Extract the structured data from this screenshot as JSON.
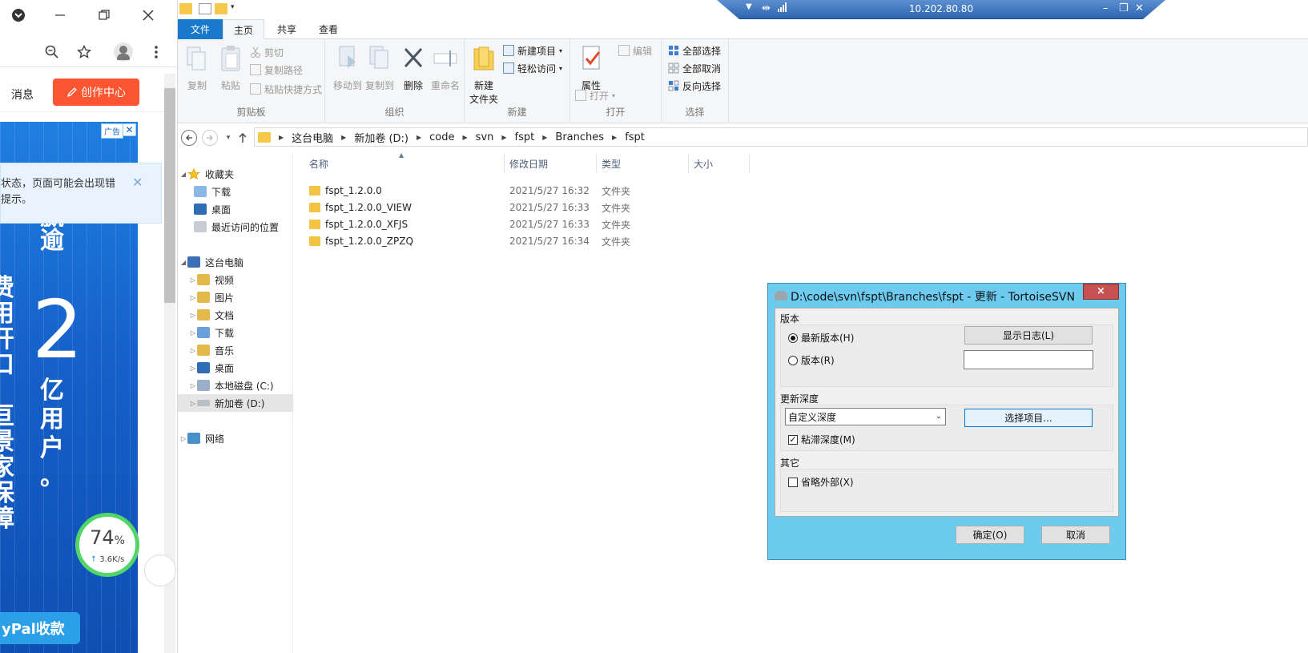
{
  "browser": {
    "zoom_icon": "zoom-out-icon",
    "star_icon": "star-icon",
    "menu_icon": "kebab-menu-icon",
    "messages_label": "消息",
    "create_center_label": "创作中心",
    "ad_badge": "广告",
    "notice_text": "状态，页面可能会出现错\n提示。",
    "ad_text": {
      "col1": [
        "赢",
        "逾"
      ],
      "big_number": "2",
      "col2": [
        "亿",
        "用",
        "户",
        "。"
      ],
      "left_chars": [
        "费",
        "用",
        "开",
        "口",
        "，",
        "亘",
        "景",
        "家",
        "保",
        "障"
      ]
    },
    "speed": {
      "percent": "74",
      "percent_sign": "%",
      "rate": "3.6K/s"
    },
    "paypal_label": "yPal收款"
  },
  "remote_bar": {
    "ip": "10.202.80.80"
  },
  "explorer": {
    "tabs": [
      {
        "label": "文件"
      },
      {
        "label": "主页"
      },
      {
        "label": "共享"
      },
      {
        "label": "查看"
      }
    ],
    "ribbon": {
      "clipboard": {
        "label": "剪贴板",
        "copy": "复制",
        "paste": "粘贴",
        "cut": "剪切",
        "copy_path": "复制路径",
        "paste_shortcut": "粘贴快捷方式"
      },
      "organize": {
        "label": "组织",
        "move_to": "移动到",
        "copy_to": "复制到",
        "delete": "删除",
        "rename": "重命名"
      },
      "new": {
        "label": "新建",
        "new_folder_line1": "新建",
        "new_folder_line2": "文件夹",
        "new_item": "新建项目",
        "easy_access": "轻松访问"
      },
      "open": {
        "label": "打开",
        "properties": "属性",
        "open": "打开",
        "edit": "编辑"
      },
      "select": {
        "label": "选择",
        "select_all": "全部选择",
        "select_none": "全部取消",
        "invert": "反向选择"
      }
    },
    "breadcrumb": [
      "这台电脑",
      "新加卷 (D:)",
      "code",
      "svn",
      "fspt",
      "Branches",
      "fspt"
    ],
    "tree": {
      "favorites": "收藏夹",
      "fav_items": [
        "下载",
        "桌面",
        "最近访问的位置"
      ],
      "this_pc": "这台电脑",
      "pc_items": [
        "视频",
        "图片",
        "文档",
        "下载",
        "音乐",
        "桌面",
        "本地磁盘 (C:)",
        "新加卷 (D:)"
      ],
      "network": "网络"
    },
    "columns": [
      "名称",
      "修改日期",
      "类型",
      "大小"
    ],
    "files": [
      {
        "name": "fspt_1.2.0.0",
        "date": "2021/5/27 16:32",
        "type": "文件夹"
      },
      {
        "name": "fspt_1.2.0.0_VIEW",
        "date": "2021/5/27 16:33",
        "type": "文件夹"
      },
      {
        "name": "fspt_1.2.0.0_XFJS",
        "date": "2021/5/27 16:33",
        "type": "文件夹"
      },
      {
        "name": "fspt_1.2.0.0_ZPZQ",
        "date": "2021/5/27 16:34",
        "type": "文件夹"
      }
    ]
  },
  "dialog": {
    "title": "D:\\code\\svn\\fspt\\Branches\\fspt - 更新 - TortoiseSVN",
    "close": "×",
    "revision_group": "版本",
    "head_revision": "最新版本(H)",
    "revision": "版本(R)",
    "show_log": "显示日志(L)",
    "revision_value": "",
    "depth_group": "更新深度",
    "depth_value": "自定义深度",
    "choose_items": "选择项目...",
    "sticky_depth": "粘滞深度(M)",
    "other_group": "其它",
    "omit_externals": "省略外部(X)",
    "ok": "确定(O)",
    "cancel": "取消"
  }
}
